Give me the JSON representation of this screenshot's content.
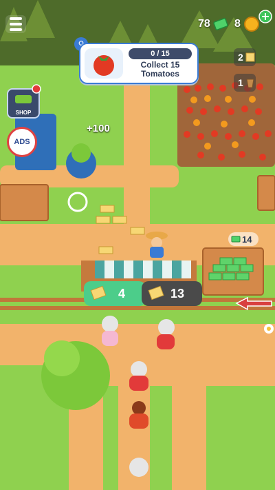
{
  "hud": {
    "cash": "78",
    "coins": "8",
    "menu_icon": "hamburger-menu-icon",
    "cash_icon": "cash-bill-icon",
    "coin_icon": "gold-coin-icon",
    "add_icon": "green-plus-icon"
  },
  "task": {
    "progress": "0 / 15",
    "text": "Collect 15 Tomatoes",
    "icon": "tomato-icon"
  },
  "side_badges": [
    {
      "value": "2",
      "icon": "cheese-block-icon"
    },
    {
      "value": "1",
      "icon": "bucket-icon"
    }
  ],
  "shop": {
    "label": "SHOP"
  },
  "ads": {
    "label": "ADS"
  },
  "popup": {
    "plus": "+100"
  },
  "stall": {
    "cheese_count": "4",
    "queue_count": "13"
  },
  "cash_stack": {
    "value": "14"
  },
  "colors": {
    "grass": "#8fd14f",
    "path": "#f2b36b",
    "accent_green": "#4ccd8a",
    "dark_panel": "#4a4a4a"
  }
}
